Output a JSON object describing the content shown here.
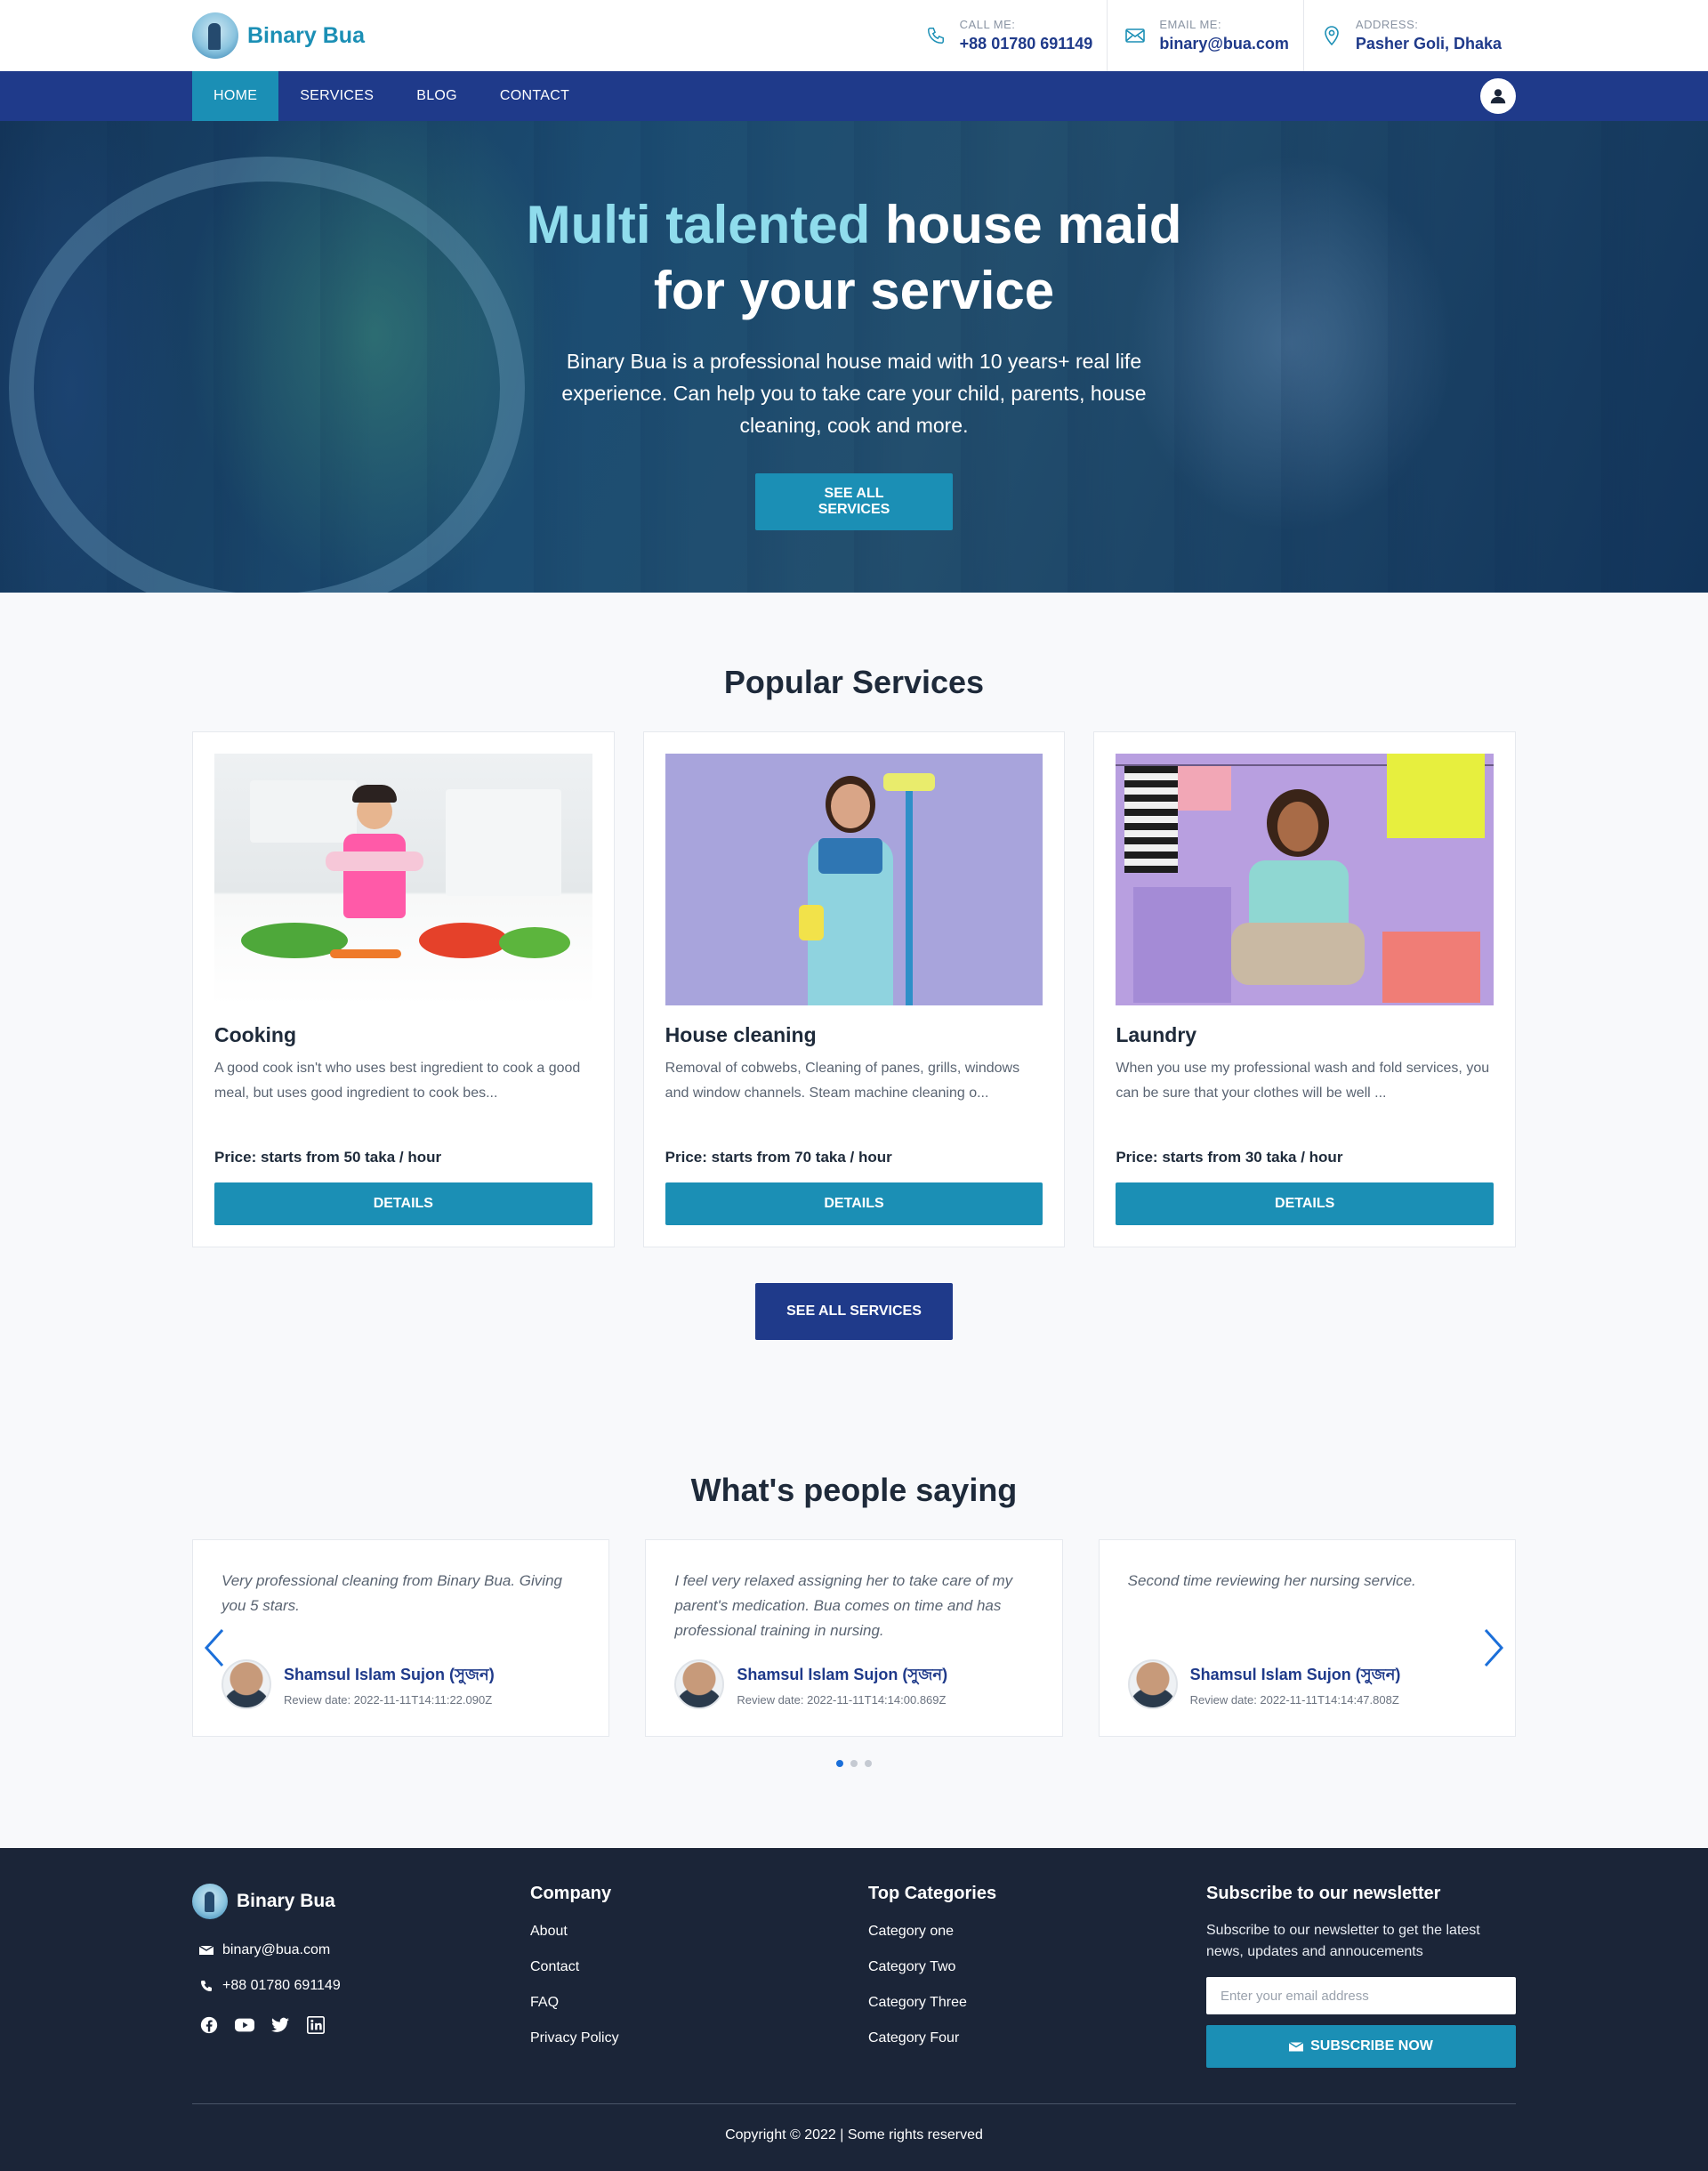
{
  "brand": {
    "name": "Binary Bua"
  },
  "header": {
    "contacts": [
      {
        "label": "CALL ME:",
        "value": "+88 01780 691149",
        "icon": "phone-icon"
      },
      {
        "label": "EMAIL ME:",
        "value": "binary@bua.com",
        "icon": "mail-icon"
      },
      {
        "label": "ADDRESS:",
        "value": "Pasher Goli, Dhaka",
        "icon": "location-pin-icon"
      }
    ]
  },
  "nav": {
    "items": [
      {
        "label": "HOME",
        "active": true
      },
      {
        "label": "SERVICES"
      },
      {
        "label": "BLOG"
      },
      {
        "label": "CONTACT"
      }
    ],
    "user_icon": "user-icon"
  },
  "hero": {
    "title_accent": "Multi talented",
    "title_rest": " house maid",
    "title_line2": "for your service",
    "subtitle": "Binary Bua is a professional house maid with 10 years+ real life experience. Can help you to take care your child, parents, house cleaning, cook and more.",
    "cta": "SEE ALL SERVICES"
  },
  "services": {
    "title": "Popular Services",
    "cards": [
      {
        "title": "Cooking",
        "desc": "A good cook isn't who uses best ingredient to cook a good meal, but uses good ingredient to cook bes...",
        "price": "Price: starts from 50 taka / hour",
        "button": "DETAILS"
      },
      {
        "title": "House cleaning",
        "desc": "Removal of cobwebs, Cleaning of panes, grills, windows and window channels. Steam machine cleaning o...",
        "price": "Price: starts from 70 taka / hour",
        "button": "DETAILS"
      },
      {
        "title": "Laundry",
        "desc": "When you use my professional wash and fold services, you can be sure that your clothes will be well ...",
        "price": "Price: starts from 30 taka / hour",
        "button": "DETAILS"
      }
    ],
    "cta": "SEE ALL SERVICES"
  },
  "testimonials": {
    "title": "What's people saying",
    "items": [
      {
        "quote": "Very professional cleaning from Binary Bua. Giving you 5 stars.",
        "name": "Shamsul Islam Sujon (সুজন)",
        "date": "Review date: 2022-11-11T14:11:22.090Z"
      },
      {
        "quote": "I feel very relaxed assigning her to take care of my parent's medication. Bua comes on time and has professional training in nursing.",
        "name": "Shamsul Islam Sujon (সুজন)",
        "date": "Review date: 2022-11-11T14:14:00.869Z"
      },
      {
        "quote": "Second time reviewing her nursing service.",
        "name": "Shamsul Islam Sujon (সুজন)",
        "date": "Review date: 2022-11-11T14:14:47.808Z"
      }
    ],
    "active_dot": 1,
    "dot_count": 3
  },
  "footer": {
    "brand": "Binary Bua",
    "email": "binary@bua.com",
    "phone": "+88 01780 691149",
    "socials": [
      "facebook-icon",
      "youtube-icon",
      "twitter-icon",
      "linkedin-icon"
    ],
    "company": {
      "heading": "Company",
      "links": [
        "About",
        "Contact",
        "FAQ",
        "Privacy Policy"
      ]
    },
    "categories": {
      "heading": "Top Categories",
      "links": [
        "Category one",
        "Category Two",
        "Category Three",
        "Category Four"
      ]
    },
    "newsletter": {
      "heading": "Subscribe to our newsletter",
      "text": "Subscribe to our newsletter to get the latest news, updates and annoucements",
      "placeholder": "Enter your email address",
      "button": "SUBSCRIBE NOW"
    },
    "copyright": "Copyright © 2022 | Some rights reserved"
  },
  "colors": {
    "brand_teal": "#1b8fb5",
    "navy": "#1f3a8a",
    "footer_bg": "#1b2538",
    "hero_accent": "#8fdcec"
  }
}
